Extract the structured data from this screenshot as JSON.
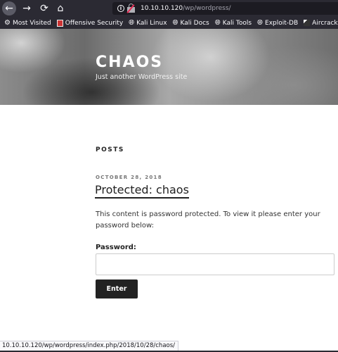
{
  "browser": {
    "url_host": "10.10.10.120",
    "url_path": "/wp/wordpress/",
    "nav_icons": {
      "back": "arrow-left-icon",
      "forward": "arrow-right-icon",
      "reload": "reload-icon",
      "home": "home-icon"
    },
    "bookmarks": [
      {
        "label": "Most Visited",
        "icon": "gear-icon"
      },
      {
        "label": "Offensive Security",
        "icon": "offsec-icon"
      },
      {
        "label": "Kali Linux",
        "icon": "globe-icon"
      },
      {
        "label": "Kali Docs",
        "icon": "globe-icon"
      },
      {
        "label": "Kali Tools",
        "icon": "globe-icon"
      },
      {
        "label": "Exploit-DB",
        "icon": "globe-icon"
      },
      {
        "label": "Aircrack",
        "icon": "aircrack-icon"
      }
    ],
    "status_url": "10.10.10.120/wp/wordpress/index.php/2018/10/28/chaos/"
  },
  "site": {
    "title": "CHAOS",
    "description": "Just another WordPress site"
  },
  "content": {
    "posts_heading": "POSTS",
    "post": {
      "date": "OCTOBER 28, 2018",
      "title": "Protected: chaos",
      "text": "This content is password protected. To view it please enter your password below:",
      "password_label": "Password:",
      "password_value": "",
      "submit_label": "Enter"
    }
  },
  "colors": {
    "chrome_bg": "#2b2a33",
    "urlbar_bg": "#1c1b22",
    "button_bg": "#222222",
    "text": "#222222"
  }
}
